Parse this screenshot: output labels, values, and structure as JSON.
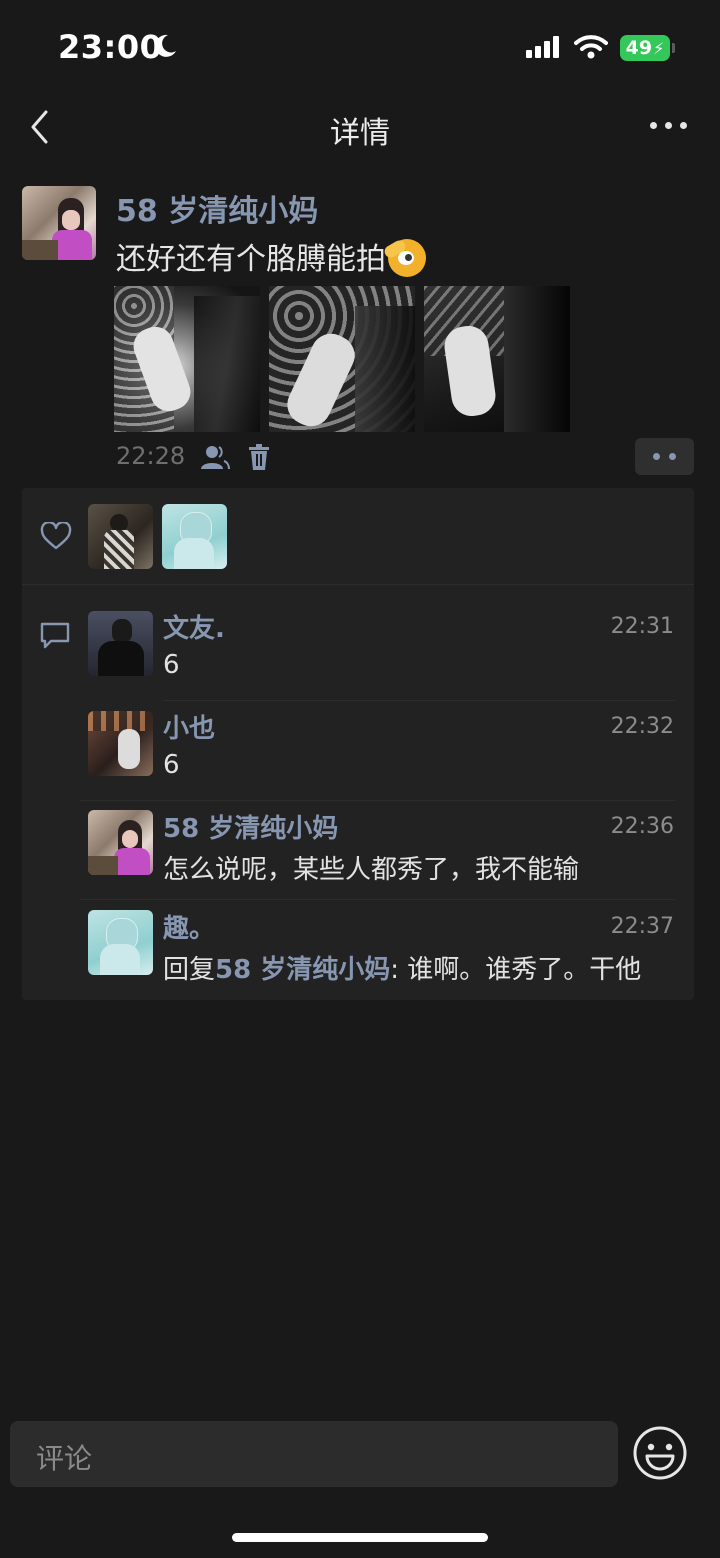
{
  "status_bar": {
    "time": "23:00",
    "battery": "49"
  },
  "nav": {
    "title": "详情"
  },
  "post": {
    "author": "58 岁清纯小妈",
    "text": "还好还有个胳膊能拍",
    "time": "22:28",
    "images": [
      "arm-photo-1",
      "arm-photo-2",
      "arm-photo-3"
    ]
  },
  "likes": {
    "count_avatars": 2
  },
  "comments": [
    {
      "name": "文友.",
      "time": "22:31",
      "text": "6"
    },
    {
      "name": "小也",
      "time": "22:32",
      "text": "6"
    },
    {
      "name": "58 岁清纯小妈",
      "time": "22:36",
      "text": "怎么说呢，某些人都秀了，我不能输"
    },
    {
      "name": "趣。",
      "time": "22:37",
      "reply_prefix": "回复",
      "reply_to": "58 岁清纯小妈",
      "text": ": 谁啊。谁秀了。干他"
    }
  ],
  "input": {
    "placeholder": "评论"
  },
  "colors": {
    "background": "#191919",
    "card": "#222222",
    "name_link": "#8796b1",
    "battery": "#34c759"
  }
}
